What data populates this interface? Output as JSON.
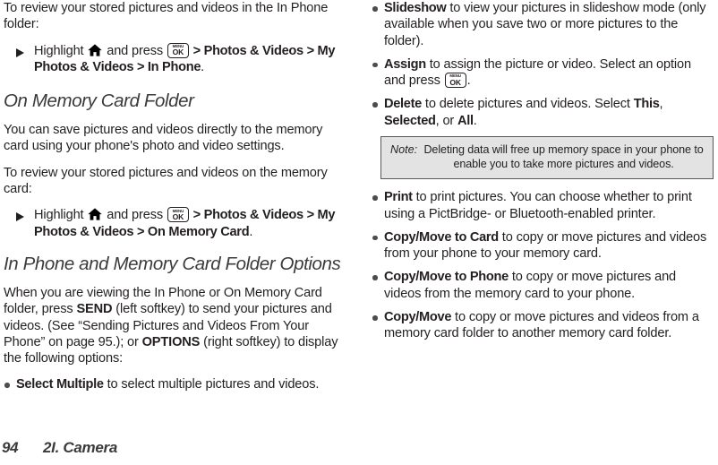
{
  "document": {
    "page_number": "94",
    "chapter": "2I. Camera"
  },
  "icons": {
    "home": "home-icon",
    "menu_ok_top": "MENU",
    "menu_ok_bottom": "OK",
    "step_marker": "triangle-right-icon",
    "bullet_marker": "round-bullet-icon"
  },
  "colors": {
    "text": "#231f20",
    "heading": "#3b3b3e",
    "note_background": "#e3e3e3",
    "note_border": "#58585b",
    "bullet": "#4d4d4f"
  },
  "left_column": {
    "intro_paragraph": "To review your stored pictures and videos in the In Phone folder:",
    "step_1": {
      "pre_home": "Highlight ",
      "post_home": " and press ",
      "after_key_bold": " > Photos & Videos > My Photos & Videos > In Phone",
      "period": "."
    },
    "heading_memory_card": "On Memory Card Folder",
    "paragraph_save": "You can save pictures and videos directly to the memory card using your phone's photo and video settings.",
    "paragraph_review": "To review your stored pictures and videos on the memory card:",
    "step_2": {
      "pre_home": "Highlight ",
      "post_home": " and press ",
      "after_key_bold": " > Photos & Videos > My Photos & Videos > On Memory Card",
      "period": "."
    },
    "heading_options": "In Phone and Memory Card Folder Options",
    "paragraph_options": {
      "p1": "When you are viewing the In Phone or On Memory Card folder, press ",
      "send": "SEND",
      "p2": " (left softkey) to send your pictures and videos. (See “Sending Pictures and Videos From Your Phone” on page 95.); or ",
      "options": "OPTIONS",
      "p3": " (right softkey) to display the following options:"
    },
    "bullets": [
      {
        "term": "Select Multiple",
        "rest": " to select multiple pictures and videos."
      }
    ]
  },
  "right_column": {
    "bullets_before_note": [
      {
        "term": "Slideshow",
        "rest": " to view your pictures in slideshow mode (only available when you save two or more pictures to the folder)."
      },
      {
        "term": "Assign",
        "rest_before_key": " to assign the picture or video. Select an option and press ",
        "rest_after_key": "."
      },
      {
        "term": "Delete",
        "rest": " to delete pictures and videos. Select ",
        "bold_a": "This",
        "sep_a": ", ",
        "bold_b": "Selected",
        "sep_b": ", or ",
        "bold_c": "All",
        "end": "."
      }
    ],
    "note": {
      "label": "Note:",
      "text": "Deleting data will free up memory space in your phone to enable you to take more pictures and videos."
    },
    "bullets_after_note": [
      {
        "term": "Print",
        "rest": " to print pictures. You can choose whether to print using a PictBridge- or Bluetooth-enabled printer."
      },
      {
        "term": "Copy/Move to Card",
        "rest": " to copy or move pictures and videos from your phone to your memory card."
      },
      {
        "term": "Copy/Move to Phone",
        "rest": " to copy or move pictures and videos from the memory card to your phone."
      },
      {
        "term": "Copy/Move",
        "rest": " to copy or move pictures and videos from a memory card folder to another memory card folder."
      }
    ]
  }
}
